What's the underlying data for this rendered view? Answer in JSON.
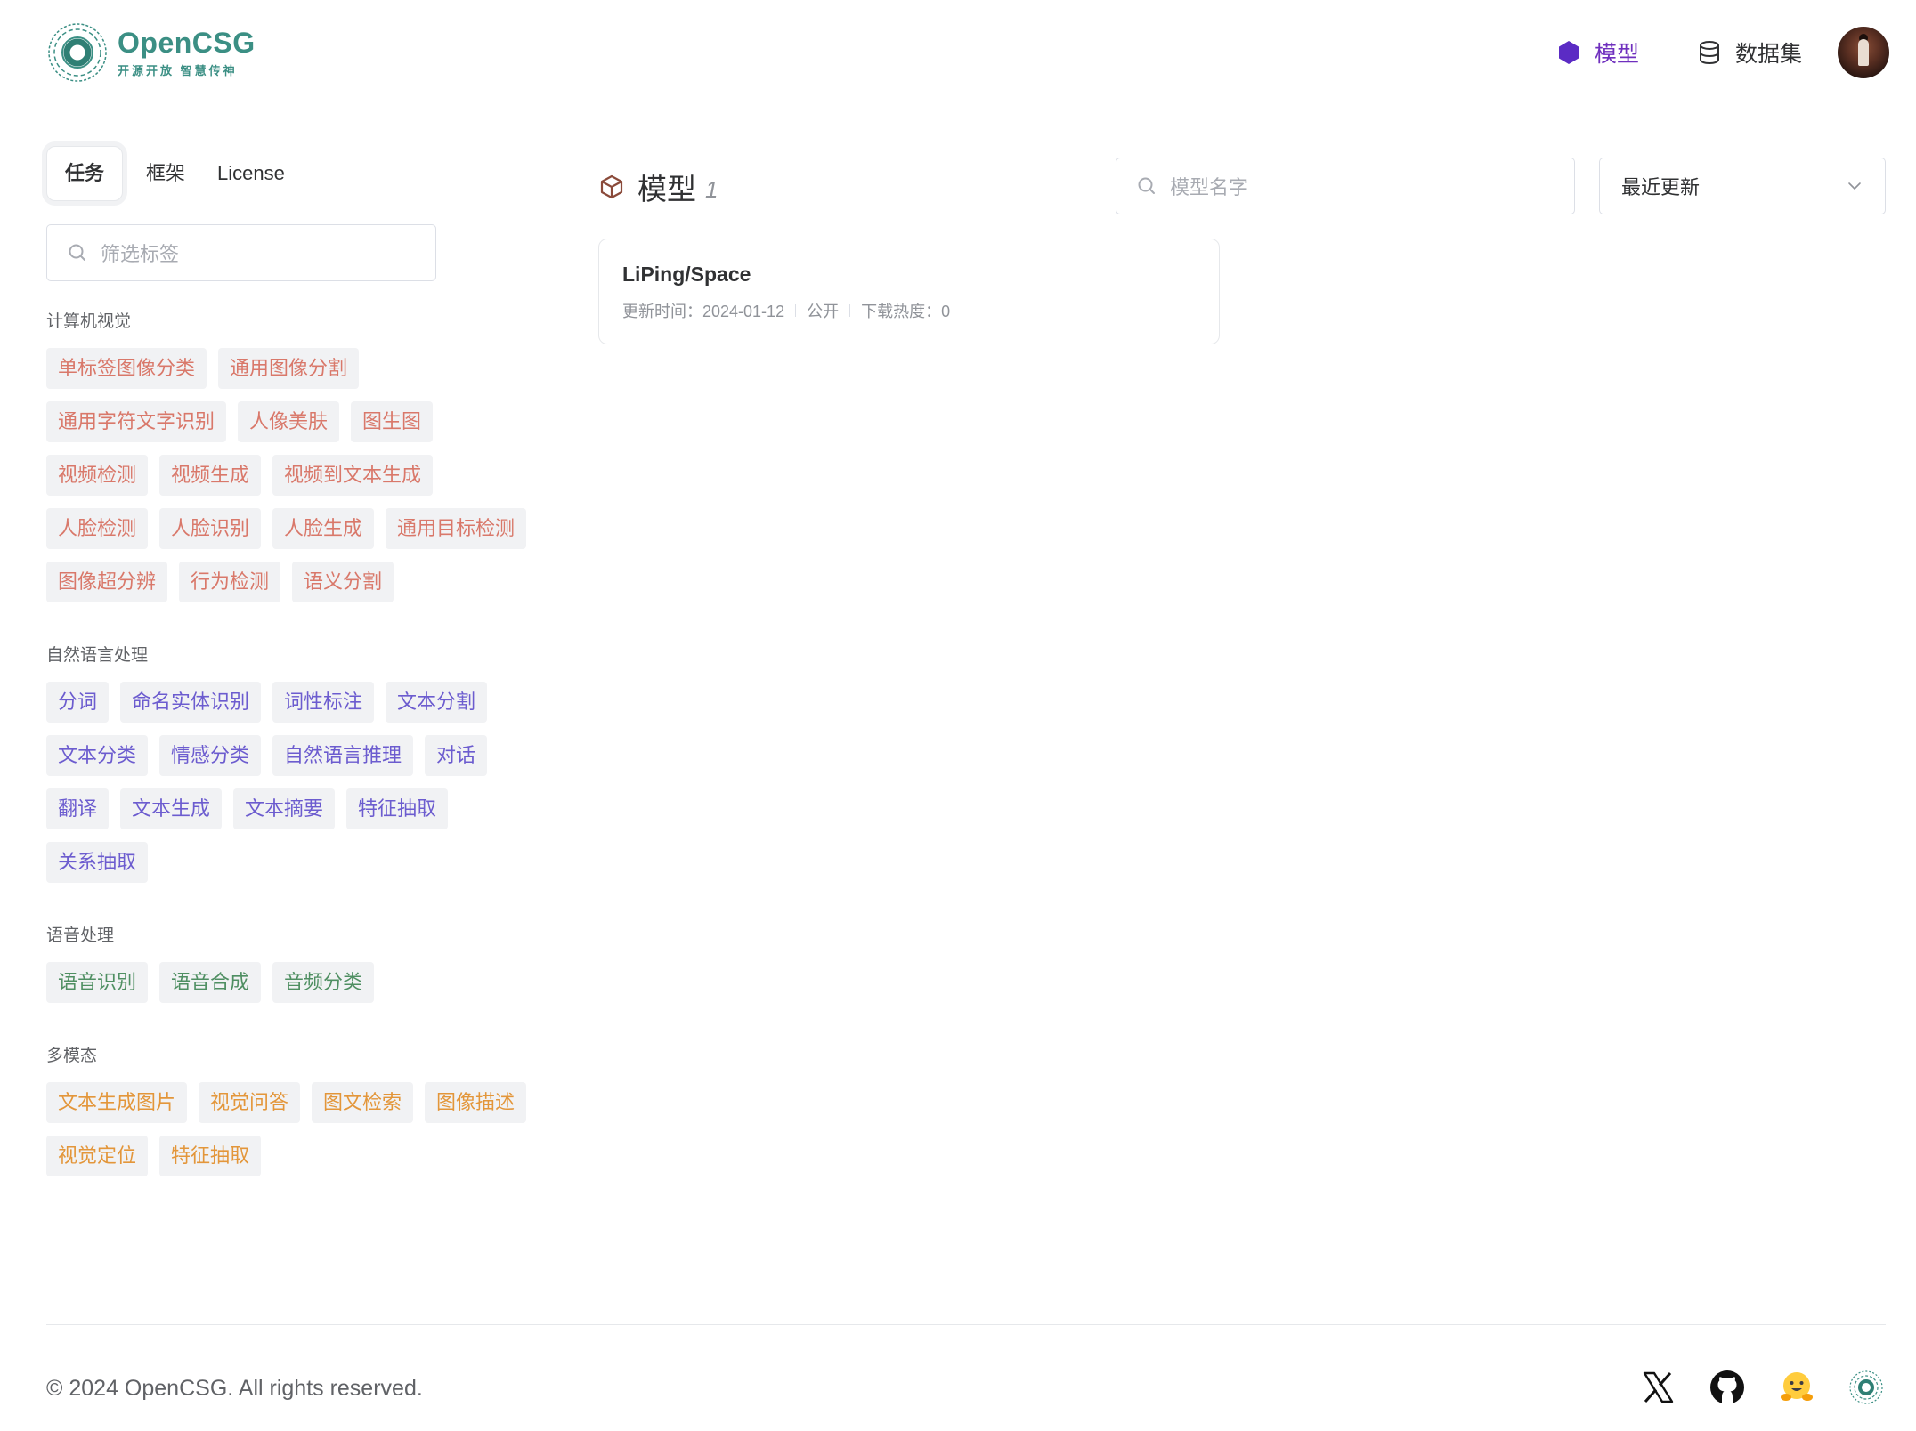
{
  "header": {
    "logo_name": "OpenCSG",
    "logo_slogan": "开源开放 智慧传神",
    "nav": [
      {
        "label": "模型",
        "icon": "hexagon-icon",
        "active": true
      },
      {
        "label": "数据集",
        "icon": "database-icon",
        "active": false
      }
    ],
    "avatar": "user-avatar"
  },
  "sidebar": {
    "tabs": [
      "任务",
      "框架",
      "License"
    ],
    "active_tab": "任务",
    "filter_placeholder": "筛选标签",
    "categories": [
      {
        "title": "计算机视觉",
        "color": "#d9786a",
        "tags": [
          "单标签图像分类",
          "通用图像分割",
          "通用字符文字识别",
          "人像美肤",
          "图生图",
          "视频检测",
          "视频生成",
          "视频到文本生成",
          "人脸检测",
          "人脸识别",
          "人脸生成",
          "通用目标检测",
          "图像超分辨",
          "行为检测",
          "语义分割"
        ]
      },
      {
        "title": "自然语言处理",
        "color": "#6c5ccf",
        "tags": [
          "分词",
          "命名实体识别",
          "词性标注",
          "文本分割",
          "文本分类",
          "情感分类",
          "自然语言推理",
          "对话",
          "翻译",
          "文本生成",
          "文本摘要",
          "特征抽取",
          "关系抽取"
        ]
      },
      {
        "title": "语音处理",
        "color": "#4f8f62",
        "tags": [
          "语音识别",
          "语音合成",
          "音频分类"
        ]
      },
      {
        "title": "多模态",
        "color": "#e3963a",
        "tags": [
          "文本生成图片",
          "视觉问答",
          "图文检索",
          "图像描述",
          "视觉定位",
          "特征抽取"
        ]
      }
    ]
  },
  "main": {
    "title": "模型",
    "count": "1",
    "search_placeholder": "模型名字",
    "sort_value": "最近更新",
    "cards": [
      {
        "name": "LiPing/Space",
        "updated": "更新时间：2024-01-12",
        "visibility": "公开",
        "downloads": "下载热度：0"
      }
    ]
  },
  "footer": {
    "copyright": "© 2024 OpenCSG. All rights reserved.",
    "social": [
      "x-icon",
      "github-icon",
      "huggingface-icon",
      "opencsg-icon"
    ]
  },
  "colors": {
    "accent": "#6f2fbe",
    "brand": "#3b8f84",
    "cv": "#d9786a",
    "nlp": "#6c5ccf",
    "audio": "#4f8f62",
    "multimodal": "#e3963a"
  }
}
